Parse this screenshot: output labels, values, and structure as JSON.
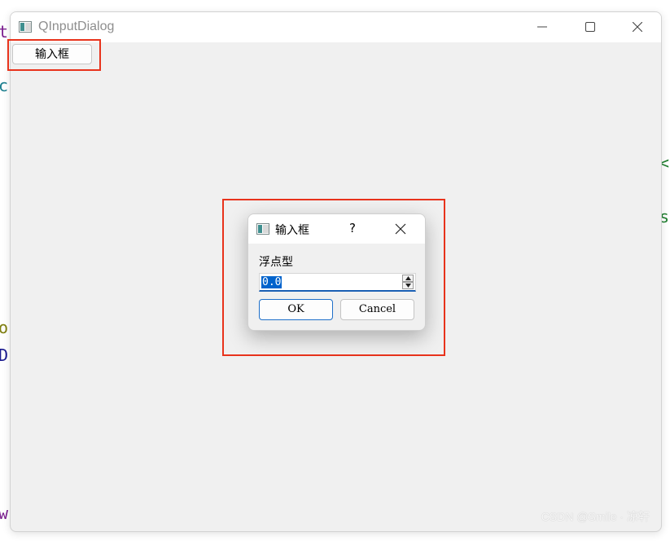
{
  "window": {
    "title": "QInputDialog",
    "open_button_label": "输入框"
  },
  "dialog": {
    "title": "输入框",
    "help_label": "?",
    "field_label": "浮点型",
    "value": "0.0",
    "ok_label": "OK",
    "cancel_label": "Cancel"
  },
  "background_glyphs": [
    "t",
    "c",
    "o",
    "D",
    "w",
    "<",
    "s"
  ],
  "watermark": "CSDN @Smile · 凉轩",
  "colors": {
    "highlight": "#e8331c",
    "selection": "#0063cc",
    "window_bg": "#f0f0f0"
  }
}
